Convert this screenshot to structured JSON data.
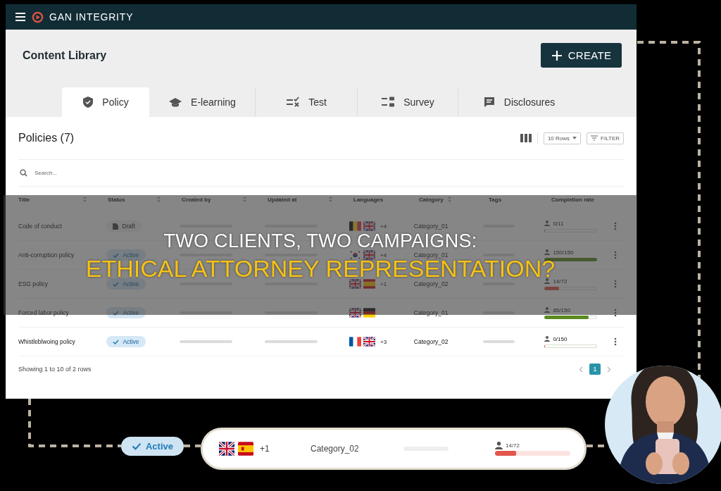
{
  "app": {
    "brand": "GAN INTEGRITY"
  },
  "page": {
    "title": "Content Library",
    "create_button": "CREATE"
  },
  "tabs": [
    {
      "label": "Policy",
      "kind": "shield",
      "selected": true
    },
    {
      "label": "E-learning",
      "kind": "cap",
      "selected": false
    },
    {
      "label": "Test",
      "kind": "checklist",
      "selected": false
    },
    {
      "label": "Survey",
      "kind": "survey",
      "selected": false
    },
    {
      "label": "Disclosures",
      "kind": "chat",
      "selected": false
    }
  ],
  "list": {
    "title": "Policies (7)",
    "rows_select": "10 Rows",
    "filter_button": "FILTER",
    "search": {
      "placeholder": "Search..."
    }
  },
  "table": {
    "columns": [
      {
        "label": "Title",
        "sortable": true
      },
      {
        "label": "Status",
        "sortable": true
      },
      {
        "label": "Created by",
        "sortable": true
      },
      {
        "label": "Updated at",
        "sortable": true
      },
      {
        "label": "Languages",
        "sortable": false
      },
      {
        "label": "Category",
        "sortable": true
      },
      {
        "label": "Tags",
        "sortable": false
      },
      {
        "label": "Completion rate",
        "sortable": false
      }
    ],
    "rows": [
      {
        "title": "Code of conduct",
        "status": {
          "kind": "draft",
          "label": "Draft"
        },
        "flags": [
          {
            "kind": "be"
          },
          {
            "kind": "gb"
          }
        ],
        "more_languages": "+4",
        "category": "Category_01",
        "completion": {
          "text": "0/11",
          "level": 0
        }
      },
      {
        "title": "Anti-corruption policy",
        "status": {
          "kind": "active",
          "label": "Active"
        },
        "flags": [
          {
            "kind": "kr"
          },
          {
            "kind": "gb"
          }
        ],
        "more_languages": "+4",
        "category": "Category_01",
        "completion": {
          "text": "150/150",
          "level": 1
        }
      },
      {
        "title": "ESG policy",
        "status": {
          "kind": "active",
          "label": "Active"
        },
        "flags": [
          {
            "kind": "gb"
          },
          {
            "kind": "es"
          }
        ],
        "more_languages": "+1",
        "category": "Category_02",
        "completion": {
          "text": "14/72",
          "level": 0.28
        }
      },
      {
        "title": "Forced labor policy",
        "status": {
          "kind": "active",
          "label": "Active"
        },
        "flags": [
          {
            "kind": "gb"
          },
          {
            "kind": "de"
          }
        ],
        "category": "Category_01",
        "completion": {
          "text": "85/150",
          "level": 0.83
        }
      },
      {
        "title": "Whistleblwoing policy",
        "status": {
          "kind": "active",
          "label": "Active"
        },
        "flags": [
          {
            "kind": "fr"
          },
          {
            "kind": "gb"
          }
        ],
        "more_languages": "+3",
        "category": "Category_02",
        "completion": {
          "text": "0/150",
          "level": 0
        }
      }
    ]
  },
  "footer": {
    "summary": "Showing 1 to 10 of 2 rows",
    "pages": [
      {
        "label": "1",
        "selected": true
      }
    ]
  },
  "banner": {
    "line_1": "TWO CLIENTS, TWO CAMPAIGNS:",
    "line_2": "ETHICAL ATTORNEY REPRESENTATION?"
  },
  "highlight": {
    "status": {
      "kind": "active",
      "label": "Active"
    },
    "flags": [
      {
        "kind": "gb"
      },
      {
        "kind": "es"
      }
    ],
    "more_languages": "+1",
    "category": "Category_02",
    "completion": {
      "text": "14/72",
      "level": 0.28
    }
  }
}
